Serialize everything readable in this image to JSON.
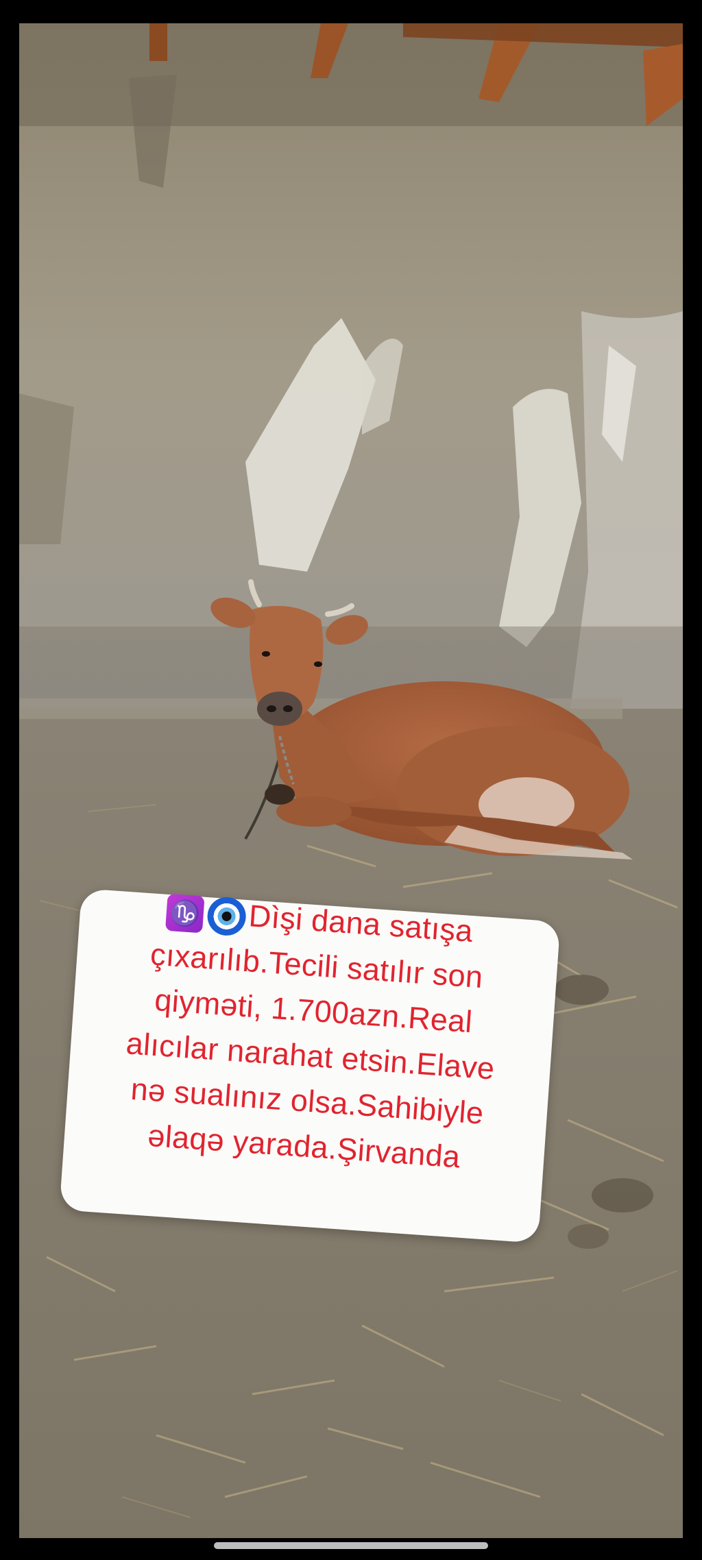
{
  "post": {
    "emoji_1": "capricorn-icon",
    "emoji_2": "nazar-amulet-icon",
    "caption_lines": [
      "Dìşi dana satışa",
      "çıxarılıb.Tecili satılır son",
      "qiyməti, 1.700azn.Real",
      "alıcılar narahat etsin.Elave",
      "nə sualınız olsa.Sahibiyle",
      "əlaqə yarada.Şirvanda"
    ],
    "caption_color": "#e0242f"
  }
}
